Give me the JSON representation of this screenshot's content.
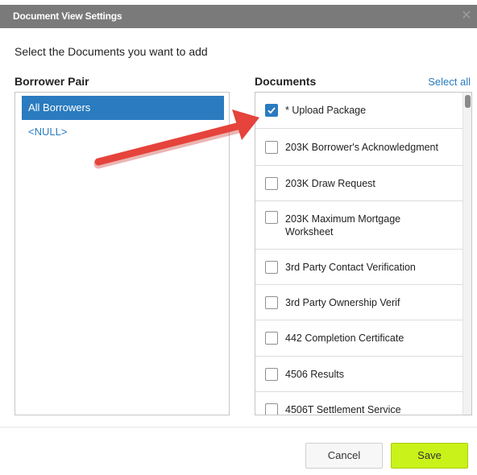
{
  "dialog": {
    "title": "Document View Settings",
    "close_icon": "close-icon",
    "instruction": "Select the Documents you want to add"
  },
  "borrower_pair": {
    "label": "Borrower Pair",
    "items": [
      {
        "label": "All Borrowers",
        "selected": true
      },
      {
        "label": "<NULL>",
        "selected": false
      }
    ]
  },
  "documents": {
    "label": "Documents",
    "select_all": "Select all",
    "items": [
      {
        "label": "* Upload Package",
        "checked": true
      },
      {
        "label": "203K Borrower's Acknowledgment",
        "checked": false
      },
      {
        "label": "203K Draw Request",
        "checked": false
      },
      {
        "label": "203K Maximum Mortgage Worksheet",
        "checked": false
      },
      {
        "label": "3rd Party Contact Verification",
        "checked": false
      },
      {
        "label": "3rd Party Ownership Verif",
        "checked": false
      },
      {
        "label": "442 Completion Certificate",
        "checked": false
      },
      {
        "label": "4506 Results",
        "checked": false
      },
      {
        "label": "4506T Settlement Service",
        "checked": false
      }
    ]
  },
  "footer": {
    "cancel_label": "Cancel",
    "save_label": "Save"
  },
  "colors": {
    "title_bar": "#7a7a7a",
    "accent_blue": "#2a7bbf",
    "save_button": "#c9f21a",
    "arrow": "#e5433b"
  }
}
